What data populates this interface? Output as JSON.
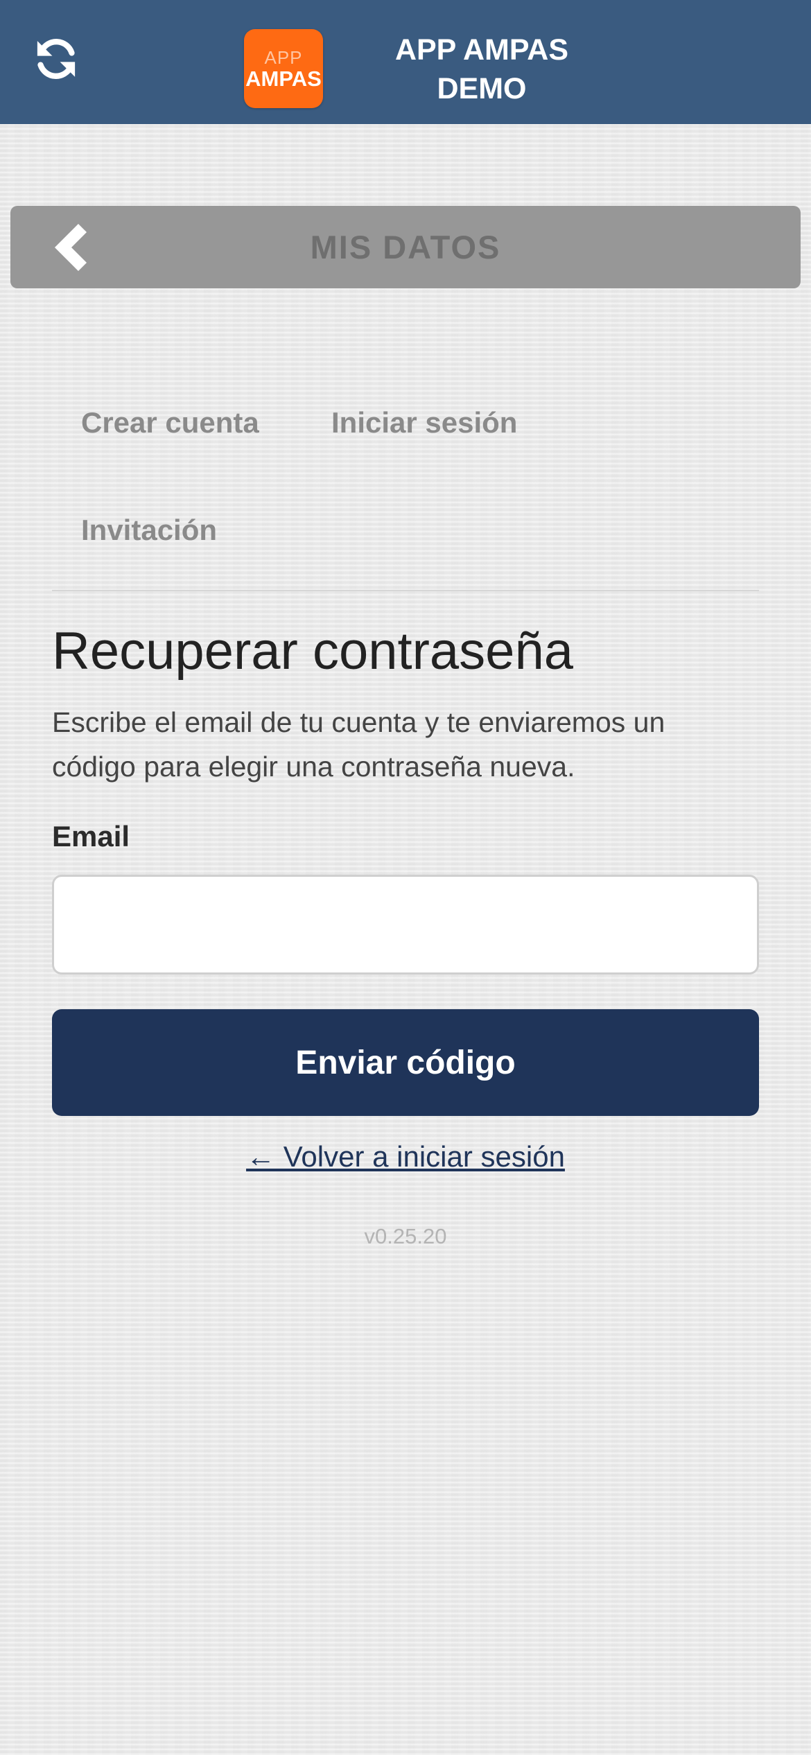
{
  "header": {
    "refresh_icon": "refresh-icon",
    "logo": {
      "top_text": "APP",
      "bottom_text": "AMPAS",
      "color": "#fe6a13"
    },
    "title_line1": "APP AMPAS",
    "title_line2": "DEMO",
    "background_color": "#3a5b80"
  },
  "section": {
    "back_icon": "chevron-left-icon",
    "title": "MIS DATOS"
  },
  "tabs": [
    {
      "label": "Crear cuenta"
    },
    {
      "label": "Iniciar sesión"
    },
    {
      "label": "Invitación"
    }
  ],
  "form": {
    "heading": "Recuperar contraseña",
    "description": "Escribe el email de tu cuenta y te enviaremos un código para elegir una contraseña nueva.",
    "email_label": "Email",
    "email_value": "",
    "email_placeholder": "",
    "submit_label": "Enviar código",
    "submit_color": "#1f3459",
    "back_link": "← Volver a iniciar sesión"
  },
  "version": "v0.25.20"
}
